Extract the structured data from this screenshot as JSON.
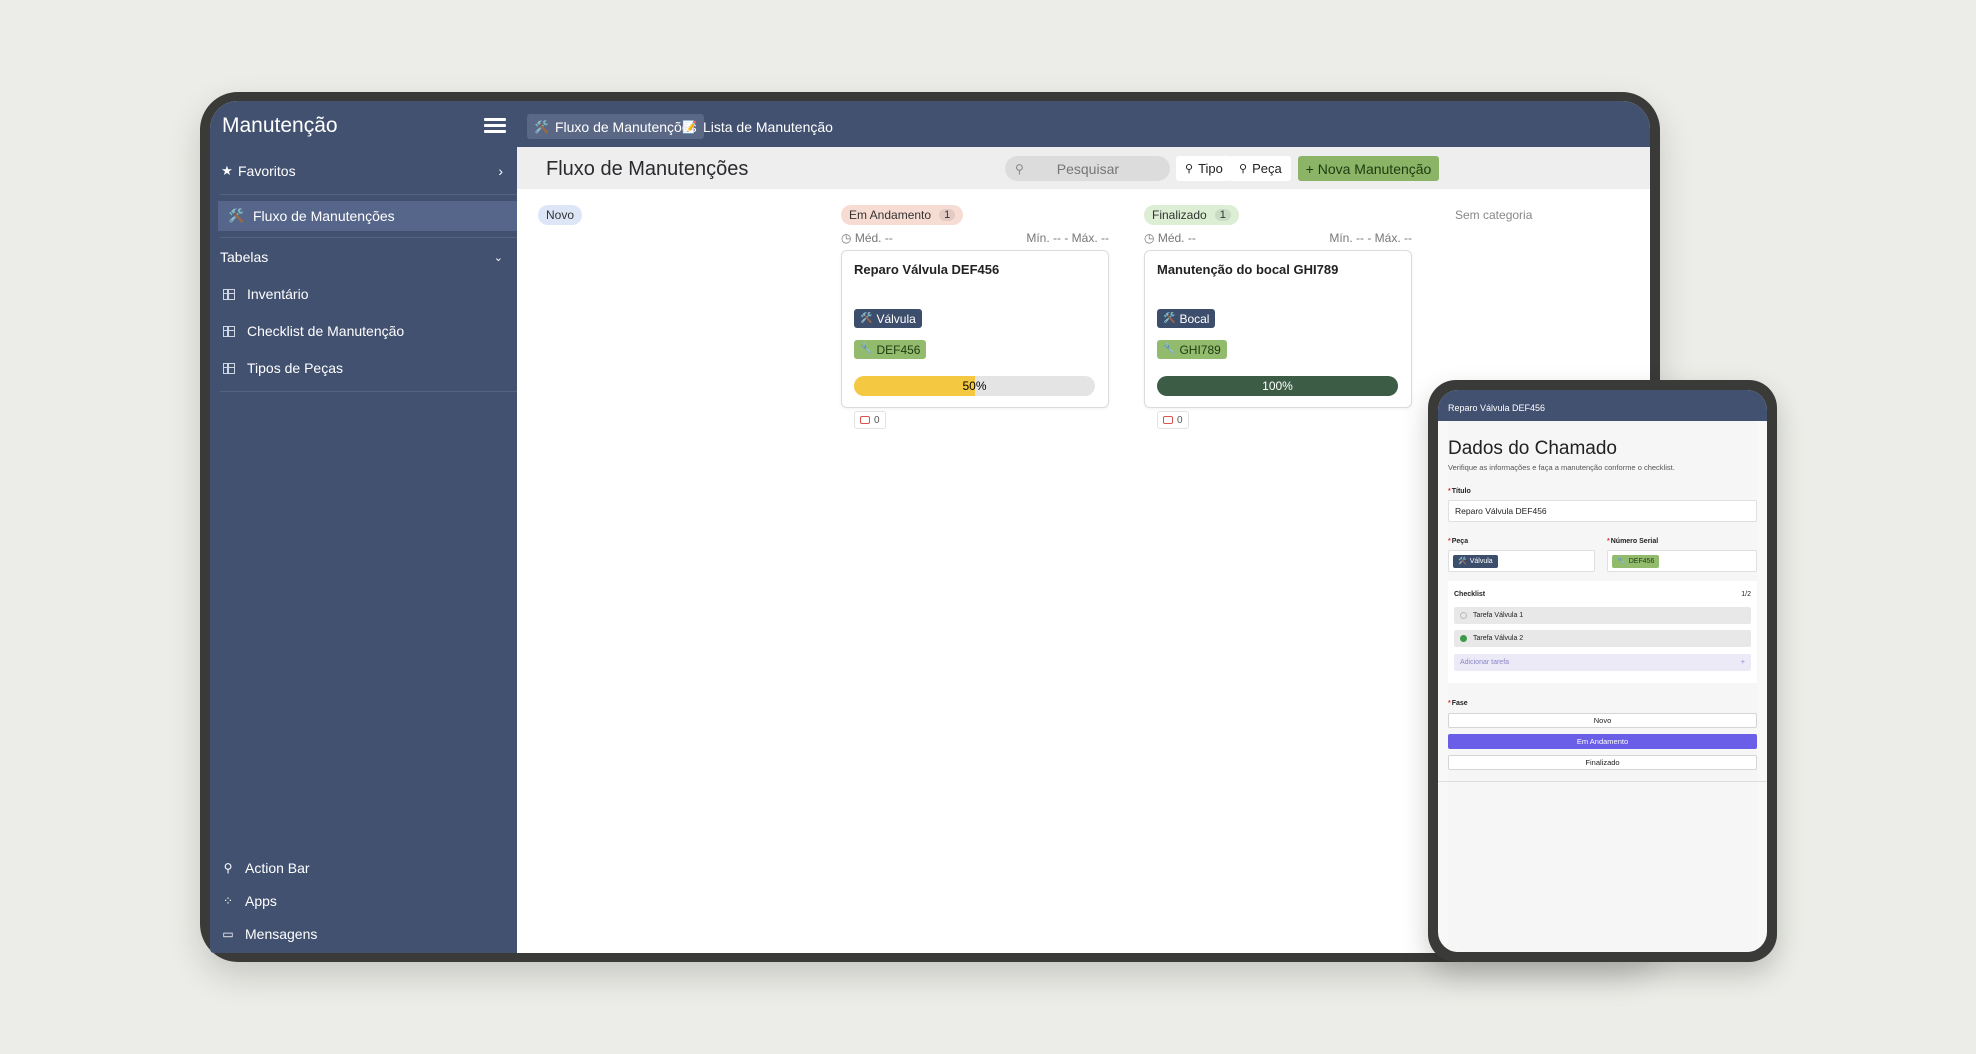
{
  "app": {
    "name": "Manutenção"
  },
  "top_tabs": [
    {
      "label": "Fluxo de Manutenções",
      "icon": "🛠️"
    },
    {
      "label": "Lista de Manutenção",
      "icon": "📝"
    }
  ],
  "sidebar": {
    "favorites": "Favoritos",
    "active_item": "Fluxo de Manutenções",
    "tables_header": "Tabelas",
    "tables": [
      "Inventário",
      "Checklist de Manutenção",
      "Tipos de Peças"
    ],
    "bottom": [
      "Action Bar",
      "Apps",
      "Mensagens"
    ]
  },
  "header": {
    "title": "Fluxo de Manutenções",
    "search_placeholder": "Pesquisar",
    "filter_tipo": "Tipo",
    "filter_peca": "Peça",
    "new_button": "+ Nova Manutenção"
  },
  "columns": [
    {
      "name": "Novo",
      "count": "",
      "color": "#dce6f7"
    },
    {
      "name": "Em Andamento",
      "count": "1",
      "color": "#f7dcd4",
      "med": "Méd. --",
      "minmax": "Mín. -- - Máx. --"
    },
    {
      "name": "Finalizado",
      "count": "1",
      "color": "#dceed4",
      "med": "Méd. --",
      "minmax": "Mín. -- - Máx. --"
    },
    {
      "name": "Sem categoria"
    }
  ],
  "cards": [
    {
      "title": "Reparo Válvula DEF456",
      "part": "Válvula",
      "serial": "DEF456",
      "progress": 50,
      "progress_label": "50%",
      "progress_color": "#f5c842",
      "comments": "0"
    },
    {
      "title": "Manutenção do bocal GHI789",
      "part": "Bocal",
      "serial": "GHI789",
      "progress": 100,
      "progress_label": "100%",
      "progress_color": "#3d5c46",
      "comments": "0"
    }
  ],
  "phone": {
    "topbar": "Reparo Válvula DEF456",
    "title": "Dados do Chamado",
    "subtitle": "Verifique as informações e faça a manutenção conforme o checklist.",
    "title_label": "Título",
    "title_value": "Reparo Válvula DEF456",
    "part_label": "Peça",
    "part_value": "Válvula",
    "serial_label": "Número Serial",
    "serial_value": "DEF456",
    "checklist_label": "Checklist",
    "checklist_count": "1/2",
    "tasks": [
      {
        "label": "Tarefa Válvula 1",
        "done": false
      },
      {
        "label": "Tarefa Válvula 2",
        "done": true
      }
    ],
    "add_task": "Adicionar tarefa",
    "phase_label": "Fase",
    "phases": [
      "Novo",
      "Em Andamento",
      "Finalizado"
    ],
    "selected_phase": "Em Andamento"
  }
}
